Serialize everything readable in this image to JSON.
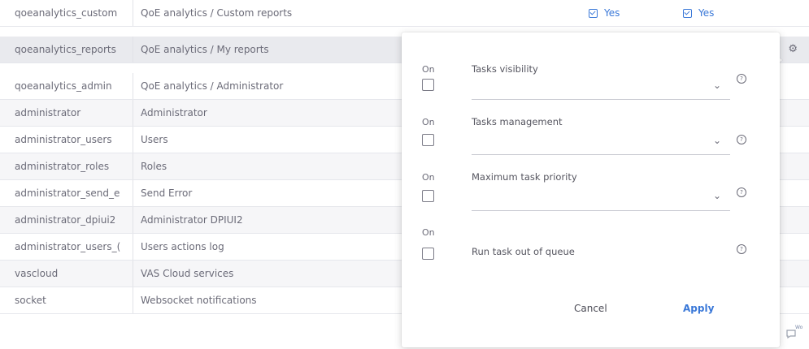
{
  "table": {
    "rows": [
      {
        "key": "qoeanalytics_custom",
        "name": "QoE analytics / Custom reports",
        "col3": "Yes",
        "col4": "Yes"
      },
      {
        "key": "qoeanalytics_reports",
        "name": "QoE analytics / My reports"
      },
      {
        "key": "qoeanalytics_admin",
        "name": "QoE analytics / Administrator"
      },
      {
        "key": "administrator",
        "name": "Administrator"
      },
      {
        "key": "administrator_users",
        "name": "Users"
      },
      {
        "key": "administrator_roles",
        "name": "Roles"
      },
      {
        "key": "administrator_send_e",
        "name": "Send Error"
      },
      {
        "key": "administrator_dpiui2",
        "name": "Administrator DPIUI2"
      },
      {
        "key": "administrator_users_(",
        "name": "Users actions log"
      },
      {
        "key": "vascloud",
        "name": "VAS Cloud services"
      },
      {
        "key": "socket",
        "name": "Websocket notifications"
      }
    ],
    "gear_icon": "⚙",
    "corner_badge": "Wo"
  },
  "popup": {
    "settings": [
      {
        "on_label": "On",
        "label": "Tasks visibility",
        "dropdown": true
      },
      {
        "on_label": "On",
        "label": "Tasks management",
        "dropdown": true
      },
      {
        "on_label": "On",
        "label": "Maximum task priority",
        "dropdown": true
      },
      {
        "on_label": "On",
        "label": "Run task out of queue",
        "dropdown": false
      }
    ],
    "cancel_label": "Cancel",
    "apply_label": "Apply",
    "chevron_glyph": "⌄",
    "help_glyph": "?"
  },
  "colors": {
    "accent": "#3a78d8",
    "row_alt": "#f6f6f8",
    "row_highlight": "#e9eaee"
  }
}
